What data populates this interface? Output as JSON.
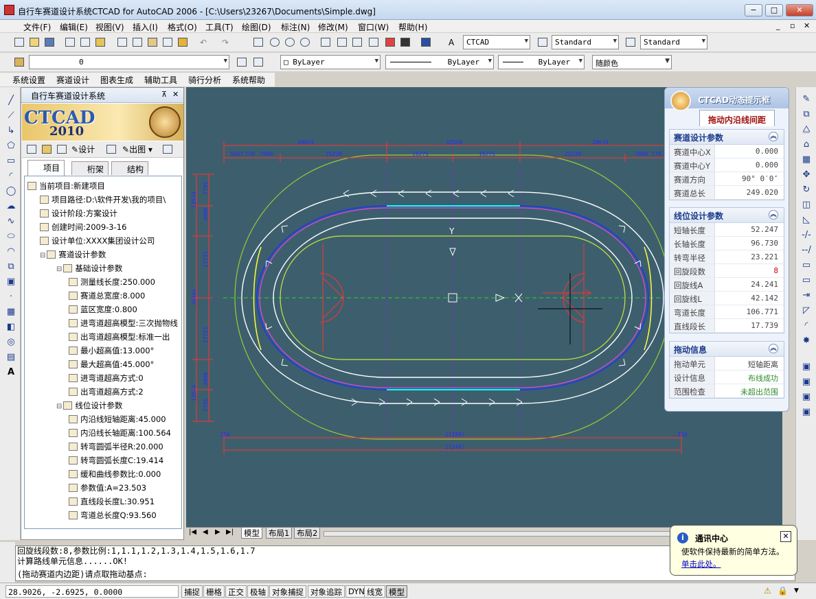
{
  "window": {
    "title": "自行车赛道设计系统CTCAD for AutoCAD 2006 - [C:\\Users\\23267\\Documents\\Simple.dwg]",
    "min": "−",
    "max": "□",
    "close": "✕"
  },
  "menu": [
    "文件(F)",
    "编辑(E)",
    "视图(V)",
    "插入(I)",
    "格式(O)",
    "工具(T)",
    "绘图(D)",
    "标注(N)",
    "修改(M)",
    "窗口(W)",
    "帮助(H)"
  ],
  "toolbar": {
    "text_style": "CTCAD",
    "dim_style": "Standard",
    "table_style": "Standard",
    "layer": "0",
    "color": "ByLayer",
    "linetype": "ByLayer",
    "lineweight": "ByLayer",
    "plot_style": "随颜色"
  },
  "menu2": [
    "系统设置",
    "赛道设计",
    "图表生成",
    "辅助工具",
    "骑行分析",
    "系统帮助"
  ],
  "panel": {
    "title": "自行车赛道设计系统",
    "pin": "⊼",
    "close": "✕",
    "logo": "CTCAD",
    "logo_year": "2010",
    "tools": {
      "design": "设计",
      "export": "出图"
    },
    "tabs": [
      "项目",
      "桁架",
      "结构"
    ],
    "tree": [
      {
        "level": 0,
        "text": "当前项目:新建项目"
      },
      {
        "level": 1,
        "text": "项目路径:D:\\软件开发\\我的项目\\"
      },
      {
        "level": 1,
        "text": "设计阶段:方案设计"
      },
      {
        "level": 1,
        "text": "创建时间:2009-3-16"
      },
      {
        "level": 1,
        "text": "设计单位:XXXX集团设计公司"
      },
      {
        "level": 1,
        "text": "赛道设计参数"
      },
      {
        "level": 2,
        "text": "基础设计参数"
      },
      {
        "level": 3,
        "text": "测量线长度:250.000"
      },
      {
        "level": 3,
        "text": "赛道总宽度:8.000"
      },
      {
        "level": 3,
        "text": "蓝区宽度:0.800"
      },
      {
        "level": 3,
        "text": "进弯道超高模型:三次抛物线"
      },
      {
        "level": 3,
        "text": "出弯道超高模型:标准一出"
      },
      {
        "level": 3,
        "text": "最小超高值:13.000°"
      },
      {
        "level": 3,
        "text": "最大超高值:45.000°"
      },
      {
        "level": 3,
        "text": "进弯道超高方式:0"
      },
      {
        "level": 3,
        "text": "出弯道超高方式:2"
      },
      {
        "level": 2,
        "text": "线位设计参数"
      },
      {
        "level": 3,
        "text": "内沿线短轴距离:45.000"
      },
      {
        "level": 3,
        "text": "内沿线长轴距离:100.564"
      },
      {
        "level": 3,
        "text": "转弯圆弧半径R:20.000"
      },
      {
        "level": 3,
        "text": "转弯圆弧长度C:19.414"
      },
      {
        "level": 3,
        "text": "缓和曲线参数比:0.000"
      },
      {
        "level": 3,
        "text": "参数值:A=23.503"
      },
      {
        "level": 3,
        "text": "直线段长度L:30.951"
      },
      {
        "level": 3,
        "text": "弯道总长度Q:93.560"
      }
    ]
  },
  "drawing": {
    "top_dims": [
      "39674",
      "32549",
      "39674"
    ],
    "top_sub_dims": [
      "5657",
      "779",
      "7000",
      "25238",
      "16275",
      "16275",
      "25238",
      "7000",
      "779"
    ],
    "left_dims": [
      "12574",
      "4000",
      "7795",
      "17721",
      "35441",
      "17721",
      "7795",
      "4000",
      "12574"
    ],
    "bottom_dims": [
      "350",
      "111897",
      "350",
      "112497"
    ],
    "axis_label": "Y"
  },
  "dyn_panel": {
    "title": "CTCAD动态提示框",
    "tab": "拖动内沿线间距",
    "sections": [
      {
        "title": "赛道设计参数",
        "rows": [
          {
            "k": "赛道中心X",
            "v": "0.000"
          },
          {
            "k": "赛道中心Y",
            "v": "0.000"
          },
          {
            "k": "赛道方向",
            "v": "90° 0′0″"
          },
          {
            "k": "赛道总长",
            "v": "249.020"
          }
        ]
      },
      {
        "title": "线位设计参数",
        "rows": [
          {
            "k": "短轴长度",
            "v": "52.247"
          },
          {
            "k": "长轴长度",
            "v": "96.730"
          },
          {
            "k": "转弯半径",
            "v": "23.221"
          },
          {
            "k": "回旋段数",
            "v": "8"
          },
          {
            "k": "回旋线A",
            "v": "24.241"
          },
          {
            "k": "回旋线L",
            "v": "42.142"
          },
          {
            "k": "弯道长度",
            "v": "106.771"
          },
          {
            "k": "直线段长",
            "v": "17.739"
          }
        ]
      },
      {
        "title": "拖动信息",
        "rows": [
          {
            "k": "拖动单元",
            "v": "短轴距离"
          },
          {
            "k": "设计信息",
            "v": "布线成功"
          },
          {
            "k": "范围检查",
            "v": "未超出范围"
          }
        ]
      }
    ],
    "collapse": "︽",
    "colors": {
      "count_value": "#cc0000",
      "success_value": "#2e8b2e"
    }
  },
  "layout_tabs": [
    "模型",
    "布局1",
    "布局2"
  ],
  "nav": [
    "|◀",
    "◀",
    "▶",
    "▶|"
  ],
  "command": {
    "lines": [
      "回旋线段数:8,参数比例:1,1.1,1.2,1.3,1.4,1.5,1.6,1.7",
      "计算路线单元信息......OK!",
      "(拖动赛道内边距)请点取拖动基点:"
    ]
  },
  "status": {
    "coords": "28.9026, -2.6925, 0.0000",
    "buttons": [
      "捕捉",
      "栅格",
      "正交",
      "极轴",
      "对象捕捉",
      "对象追踪",
      "DYN",
      "线宽",
      "模型"
    ]
  },
  "notify": {
    "title": "通讯中心",
    "message": "使软件保持最新的简单方法。",
    "link": "单击此处。",
    "close": "✕"
  }
}
